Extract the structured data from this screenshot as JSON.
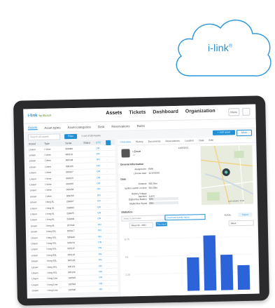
{
  "cloud": {
    "text": "i-link",
    "mark": "®"
  },
  "app": {
    "logo": "i-link",
    "logo_sub": "by Bosch",
    "nav": [
      "Assets",
      "Tickets",
      "Dashboard",
      "Organization"
    ],
    "nav_active": 0,
    "user_button": "Menu"
  },
  "subtabs": [
    "Assets",
    "Asset types",
    "Asset categories",
    "Data",
    "Reservations",
    "Rules"
  ],
  "toolbar": {
    "search_placeholder": "Search all assets",
    "filter_label": "Filter",
    "count": "1 out of 28 Assets",
    "add_label": "+ Add asset",
    "more_label": "More"
  },
  "table": {
    "headers": [
      "Brand",
      "Type",
      "Serial",
      "Status",
      "ETC",
      ""
    ],
    "rows": [
      [
        "Linsen",
        "i-Vene",
        "000086",
        "",
        "ON",
        "-"
      ],
      [
        "Linsen",
        "i-Vene",
        "000101",
        "",
        "ON",
        "-"
      ],
      [
        "Linsen",
        "i-Vene",
        "000104",
        "",
        "ON",
        "-"
      ],
      [
        "Linsen",
        "i-Vene",
        "000105",
        "",
        "ON",
        "-"
      ],
      [
        "Linsen",
        "i-Vene",
        "000107",
        "",
        "ON",
        "-"
      ],
      [
        "Linsen",
        "i-Vene",
        "000215",
        "",
        "ON",
        "-"
      ],
      [
        "Linsen",
        "i-Vene",
        "000255",
        "",
        "ON",
        "-"
      ],
      [
        "Linsen",
        "i-Vene",
        "000258",
        "",
        "ON",
        "-"
      ],
      [
        "Linsen",
        "i-Vene",
        "000258",
        "",
        "ON",
        "-"
      ],
      [
        "Linsen",
        "i-Inng 6L",
        "239267",
        "",
        "ON",
        "-"
      ],
      [
        "Linsen",
        "i-Inng 6L",
        "239283",
        "",
        "ON",
        "-"
      ],
      [
        "Linsen",
        "i-Inng 6L",
        "239975",
        "",
        "ON",
        "-"
      ],
      [
        "Linsen",
        "i-Inng 6L",
        "243208",
        "",
        "ON",
        "-"
      ],
      [
        "Linsen",
        "i-Inng 6L",
        "247649",
        "",
        "ON",
        "-"
      ],
      [
        "Linsen",
        "i-Inng 6XL",
        "505917",
        "",
        "ON",
        "-"
      ],
      [
        "Linsen",
        "i-Inng 6XL",
        "505948",
        "",
        "ON",
        "-"
      ],
      [
        "Linsen",
        "i-Inng 6XL",
        "505079",
        "",
        "ON",
        "-"
      ],
      [
        "Linsen",
        "i-Inng 6XL",
        "505115",
        "",
        "ON",
        "-"
      ],
      [
        "Linsen",
        "i-Inng 6XL",
        "505118",
        "",
        "ON",
        "-"
      ],
      [
        "Linsen",
        "i-Inng 6XL",
        "505129",
        "",
        "ON",
        "-"
      ],
      [
        "Linsen",
        "i-Inng 6XL",
        "505151",
        "",
        "ON",
        "-"
      ],
      [
        "Linsen",
        "i-Inng 6XL",
        "505156",
        "",
        "ON",
        "-"
      ],
      [
        "Linsen",
        "i-Inng Line",
        "192569",
        "",
        "ON",
        "-"
      ],
      [
        "Linsen",
        "i-Inng Line",
        "192584",
        "",
        "ON",
        "-"
      ],
      [
        "Linsen",
        "i-Inng Line",
        "192595",
        "",
        "ON",
        "-"
      ]
    ]
  },
  "detail": {
    "tabs": [
      "Overview",
      "History",
      "Documents",
      "Reservations",
      "Location",
      "Data",
      "Edit"
    ],
    "active_tab": 0,
    "asset_name": "i-Drive",
    "asset_sub": "A7",
    "asset_date": "14/06/2021",
    "section_general": "General Information",
    "general": [
      {
        "k": "Assigned to",
        "v": "KMA"
      },
      {
        "k": "License start",
        "v": "11/12/2020"
      }
    ],
    "section_data": "Data",
    "data": [
      {
        "k": "Runtime",
        "v": "680.59m"
      },
      {
        "k": "Ignition switch on time",
        "v": "604.58m"
      },
      {
        "k": "Battery Voltage Machine",
        "v": "0.45V"
      },
      {
        "k": "Digital Bus Battery",
        "v": "50%"
      },
      {
        "k": "Digital Bus Signal",
        "v": "20%"
      }
    ],
    "map_label": "Last updated: 15:06",
    "stats_title": "Statistics",
    "stats_select": "Select a parameter",
    "stats_download": "Download activity report",
    "stats_week": "Week 30 - 2021",
    "stats_button": "This week",
    "stats_activity": "Activity",
    "stats_export": "Export",
    "stats_range": "Week"
  },
  "chart_data": {
    "type": "bar",
    "categories": [
      "Mon",
      "Tue",
      "Wed",
      "Thu",
      "Fri",
      "Sat",
      "Sun"
    ],
    "values": [
      0,
      0,
      0,
      3.4,
      5.6,
      3.6,
      2.5
    ],
    "ylim": [
      0,
      6
    ],
    "ytick_labels": [
      "6.75",
      "4.5",
      "2.25"
    ],
    "bar_color": "#2c63d8"
  }
}
